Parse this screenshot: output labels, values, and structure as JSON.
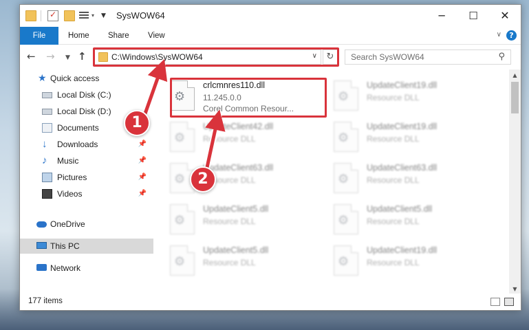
{
  "window": {
    "title": "SysWOW64"
  },
  "ribbon": {
    "tabs": [
      "File",
      "Home",
      "Share",
      "View"
    ]
  },
  "address": {
    "path": "C:\\Windows\\SysWOW64"
  },
  "search": {
    "placeholder": "Search SysWOW64"
  },
  "navpane": {
    "items": [
      {
        "label": "Quick access",
        "icon": "star-icon",
        "pinned": false
      },
      {
        "label": "Local Disk (C:)",
        "icon": "drive-icon",
        "pinned": false
      },
      {
        "label": "Local Disk (D:)",
        "icon": "drive-icon",
        "pinned": false
      },
      {
        "label": "Documents",
        "icon": "documents-icon",
        "pinned": true
      },
      {
        "label": "Downloads",
        "icon": "download-icon",
        "pinned": true
      },
      {
        "label": "Music",
        "icon": "music-icon",
        "pinned": true
      },
      {
        "label": "Pictures",
        "icon": "pictures-icon",
        "pinned": true
      },
      {
        "label": "Videos",
        "icon": "video-icon",
        "pinned": true
      },
      {
        "label": "OneDrive",
        "icon": "cloud-icon",
        "pinned": false
      },
      {
        "label": "This PC",
        "icon": "computer-icon",
        "pinned": false,
        "selected": true
      },
      {
        "label": "Network",
        "icon": "network-icon",
        "pinned": false
      }
    ]
  },
  "files": [
    {
      "name": "crlcmnres110.dll",
      "line2": "11.245.0.0",
      "line3": "Corel Common Resour...",
      "highlighted": true
    },
    {
      "name": "UpdateClient19.dll",
      "line2": "Resource DLL"
    },
    {
      "name": "UpdateClient42.dll",
      "line2": "Resource DLL"
    },
    {
      "name": "UpdateClient19.dll",
      "line2": "Resource DLL"
    },
    {
      "name": "UpdateClient63.dll",
      "line2": "Resource DLL"
    },
    {
      "name": "UpdateClient63.dll",
      "line2": "Resource DLL"
    },
    {
      "name": "UpdateClient5.dll",
      "line2": "Resource DLL"
    },
    {
      "name": "UpdateClient5.dll",
      "line2": "Resource DLL"
    },
    {
      "name": "UpdateClient5.dll",
      "line2": "Resource DLL"
    },
    {
      "name": "UpdateClient19.dll",
      "line2": "Resource DLL"
    }
  ],
  "status": {
    "item_count": "177 items"
  },
  "annotations": {
    "step1": "1",
    "step2": "2",
    "color": "#d9333b"
  },
  "colors": {
    "accent": "#1979ca",
    "selection": "#d9d9d9",
    "highlight": "#d9333b"
  }
}
